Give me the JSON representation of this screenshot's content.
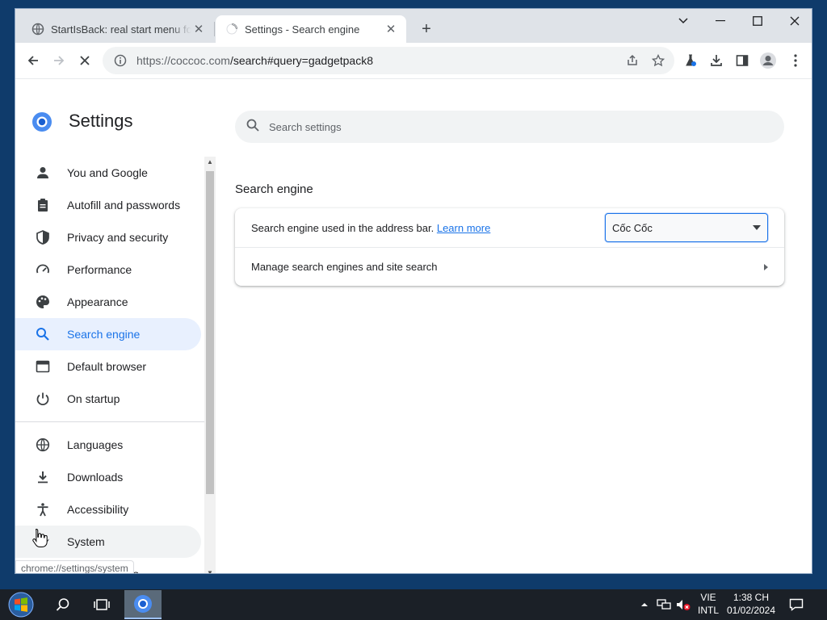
{
  "tabs": [
    {
      "title": "StartIsBack: real start menu for Windows",
      "active": false
    },
    {
      "title": "Settings - Search engine",
      "active": true
    }
  ],
  "address_bar": {
    "url_host": "https://coccoc.com",
    "url_path": "/search#query=gadgetpack8"
  },
  "settings": {
    "title": "Settings",
    "search_placeholder": "Search settings"
  },
  "sidebar": {
    "items": [
      {
        "label": "You and Google",
        "icon": "person-icon"
      },
      {
        "label": "Autofill and passwords",
        "icon": "clipboard-icon"
      },
      {
        "label": "Privacy and security",
        "icon": "shield-icon"
      },
      {
        "label": "Performance",
        "icon": "speedometer-icon"
      },
      {
        "label": "Appearance",
        "icon": "palette-icon"
      },
      {
        "label": "Search engine",
        "icon": "search-icon",
        "selected": true
      },
      {
        "label": "Default browser",
        "icon": "browser-window-icon"
      },
      {
        "label": "On startup",
        "icon": "power-icon"
      },
      {
        "label": "Languages",
        "icon": "globe-icon"
      },
      {
        "label": "Downloads",
        "icon": "download-icon"
      },
      {
        "label": "Accessibility",
        "icon": "accessibility-icon"
      },
      {
        "label": "System",
        "icon": "wrench-icon",
        "hover": true
      },
      {
        "label": "Reset settings",
        "icon": "reset-icon"
      }
    ]
  },
  "status_tooltip": "chrome://settings/system",
  "main": {
    "section_title": "Search engine",
    "rows": {
      "address_bar_label": "Search engine used in the address bar.",
      "learn_more": "Learn more",
      "selected_engine": "Cốc Cốc",
      "manage_label": "Manage search engines and site search"
    }
  },
  "taskbar": {
    "lang_top": "VIE",
    "lang_bottom": "INTL",
    "time": "1:38 CH",
    "date": "01/02/2024"
  },
  "colors": {
    "accent": "#1a73e8",
    "selected_bg": "#e8f0fe",
    "taskbar": "#1b2027"
  }
}
